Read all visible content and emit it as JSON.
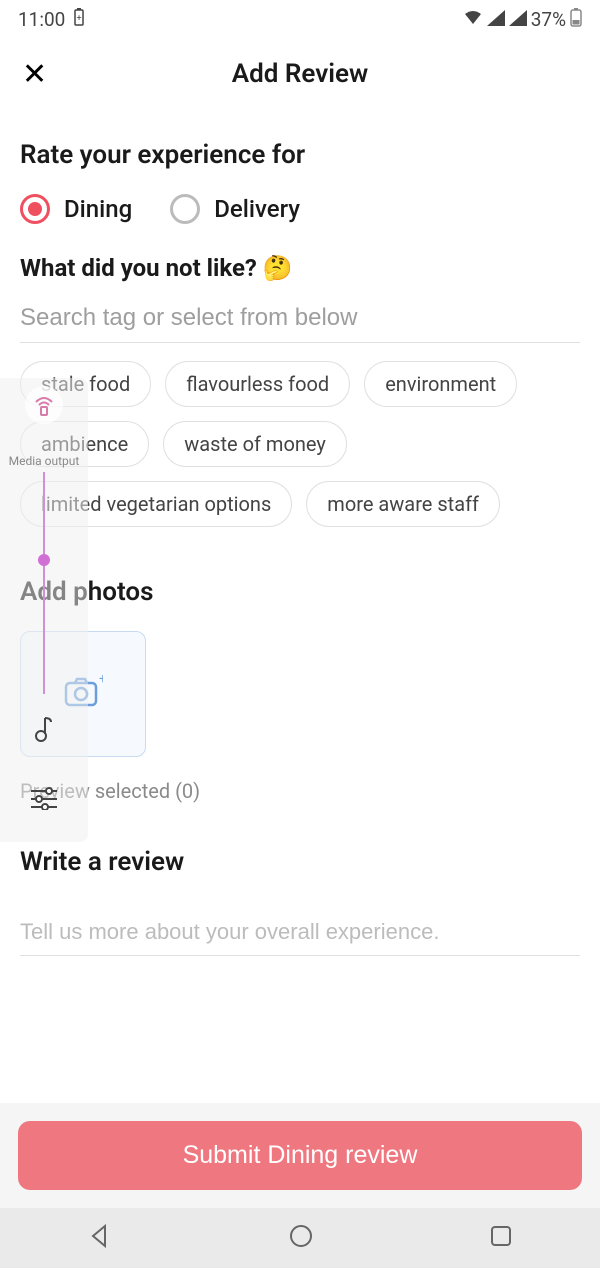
{
  "status_bar": {
    "time": "11:00",
    "battery_percent": "37%"
  },
  "header": {
    "title": "Add Review"
  },
  "rate_section": {
    "title": "Rate your experience for",
    "options": [
      {
        "label": "Dining",
        "selected": true
      },
      {
        "label": "Delivery",
        "selected": false
      }
    ]
  },
  "tags_section": {
    "question": "What did you not like?",
    "emoji": "🤔",
    "search_placeholder": "Search tag or select from below",
    "chips": [
      "stale food",
      "flavourless food",
      "environment",
      "ambience",
      "waste of money",
      "limited vegetarian options",
      "more aware staff"
    ]
  },
  "photos_section": {
    "title": "Add photos",
    "preview_label": "Preview selected (0)"
  },
  "review_section": {
    "title": "Write a review",
    "placeholder": "Tell us more about your overall experience."
  },
  "submit_label": "Submit Dining review",
  "media_overlay": {
    "label": "Media output"
  }
}
